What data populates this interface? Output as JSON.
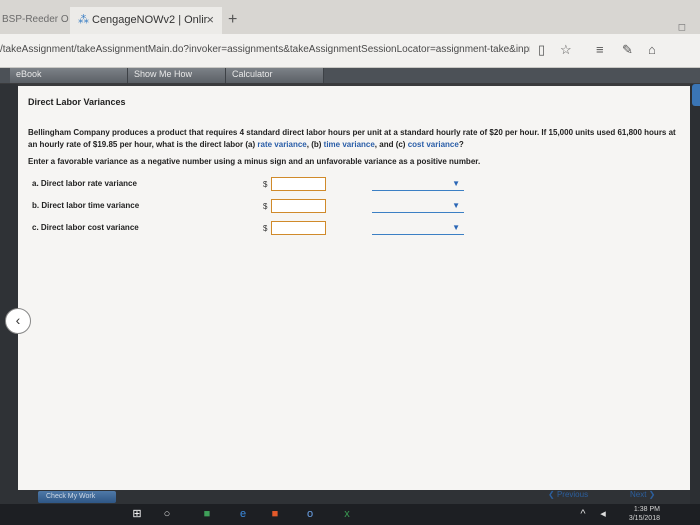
{
  "browser": {
    "inactive_tab": "BSP-Reeder O",
    "active_tab": "CengageNOWv2 | Onlir",
    "close_glyph": "×",
    "new_tab_glyph": "+",
    "url": "/takeAssignment/takeAssignmentMain.do?invoker=assignments&takeAssignmentSessionLocator=assignment-take&inpr"
  },
  "toolbar": {
    "ebook": "eBook",
    "show_me_how": "Show Me How",
    "calculator": "Calculator"
  },
  "problem": {
    "title": "Direct Labor Variances",
    "para_lead": "Bellingham Company produces a product that requires 4 standard direct labor hours per unit at a standard hourly rate of $20 per hour. If 15,000 units used 61,800 hours at an hourly rate of $19.85 per hour, what is the direct labor (a) ",
    "rate_variance": "rate variance",
    "para_mid": ", (b) ",
    "time_variance": "time variance",
    "para_and": ", and (c) ",
    "cost_variance": "cost variance",
    "para_end": "?",
    "instructions": "Enter a favorable variance as a negative number using a minus sign and an unfavorable variance as a positive number.",
    "rows": [
      {
        "label": "a.  Direct labor rate variance",
        "currency": "$",
        "value": "",
        "selection": ""
      },
      {
        "label": "b.  Direct labor time variance",
        "currency": "$",
        "value": "",
        "selection": ""
      },
      {
        "label": "c.  Direct labor cost variance",
        "currency": "$",
        "value": "",
        "selection": ""
      }
    ]
  },
  "footer": {
    "check_my_work": "Check My Work",
    "previous": "Previous",
    "next": "Next"
  },
  "taskbar": {
    "time": "1:38 PM",
    "date": "3/15/2018"
  }
}
